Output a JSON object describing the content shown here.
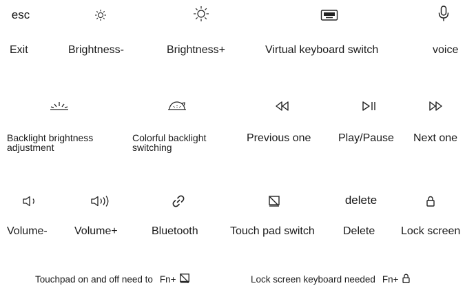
{
  "rows": [
    {
      "keys": [
        {
          "key_text": "esc",
          "icon": "",
          "label": "Exit"
        },
        {
          "key_text": "",
          "icon": "sun-small-icon",
          "label": "Brightness-"
        },
        {
          "key_text": "",
          "icon": "sun-large-icon",
          "label": "Brightness+"
        },
        {
          "key_text": "",
          "icon": "keyboard-icon",
          "label": "Virtual keyboard switch"
        },
        {
          "key_text": "",
          "icon": "microphone-icon",
          "label": "voice"
        }
      ]
    },
    {
      "keys": [
        {
          "key_text": "",
          "icon": "backlight-icon",
          "label": "Backlight brightness adjustment"
        },
        {
          "key_text": "",
          "icon": "colorful-backlight-icon",
          "label": "Colorful backlight switching"
        },
        {
          "key_text": "",
          "icon": "rewind-icon",
          "label": "Previous one"
        },
        {
          "key_text": "",
          "icon": "play-pause-icon",
          "label": "Play/Pause"
        },
        {
          "key_text": "",
          "icon": "fast-forward-icon",
          "label": "Next one"
        }
      ]
    },
    {
      "keys": [
        {
          "key_text": "",
          "icon": "volume-down-icon",
          "label": "Volume-"
        },
        {
          "key_text": "",
          "icon": "volume-up-icon",
          "label": "Volume+"
        },
        {
          "key_text": "",
          "icon": "link-icon",
          "label": "Bluetooth"
        },
        {
          "key_text": "",
          "icon": "touchpad-off-icon",
          "label": "Touch pad switch"
        },
        {
          "key_text": "delete",
          "icon": "",
          "label": "Delete"
        },
        {
          "key_text": "",
          "icon": "lock-icon",
          "label": "Lock screen"
        }
      ]
    }
  ],
  "footer": {
    "touchpad_note": "Touchpad on and off need to",
    "touchpad_combo": "Fn+",
    "lock_note": "Lock screen keyboard needed",
    "lock_combo": "Fn+"
  }
}
